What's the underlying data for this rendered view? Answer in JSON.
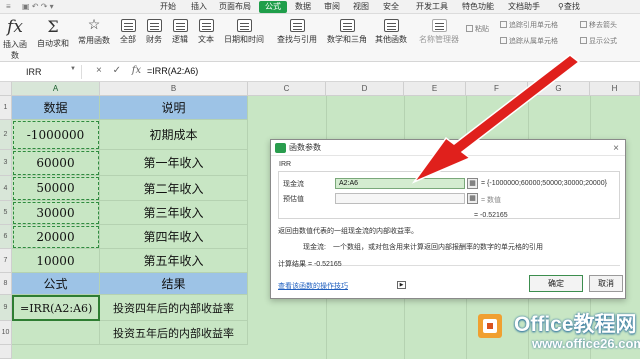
{
  "ribbon": {
    "tabs": [
      "开始",
      "插入",
      "页面布局",
      "公式",
      "数据",
      "审阅",
      "视图",
      "安全",
      "开发工具",
      "特色功能",
      "文档助手"
    ],
    "active_tab": "公式",
    "search_label": "查找",
    "buttons": [
      {
        "label": "插入函数",
        "icon": "fx"
      },
      {
        "label": "自动求和",
        "icon": "Σ"
      },
      {
        "label": "常用函数",
        "icon": "star"
      },
      {
        "label": "全部",
        "icon": "grid"
      },
      {
        "label": "财务",
        "icon": "grid"
      },
      {
        "label": "逻辑",
        "icon": "grid"
      },
      {
        "label": "文本",
        "icon": "grid"
      },
      {
        "label": "日期和时间",
        "icon": "grid"
      },
      {
        "label": "查找与引用",
        "icon": "grid"
      },
      {
        "label": "数学和三角",
        "icon": "grid"
      },
      {
        "label": "其他函数",
        "icon": "grid"
      }
    ],
    "name_manager": "名称管理器",
    "paste": "粘贴",
    "right_items": [
      "追踪引用单元格",
      "追踪从属单元格",
      "移去箭头",
      "显示公式"
    ]
  },
  "formula_bar": {
    "name_box": "IRR",
    "cancel_icon": "×",
    "confirm_icon": "✓",
    "fx_label": "fx",
    "formula": "=IRR(A2:A6)"
  },
  "columns": [
    "A",
    "B",
    "C",
    "D",
    "E",
    "F",
    "G",
    "H"
  ],
  "rows": [
    "1",
    "2",
    "3",
    "4",
    "5",
    "6",
    "7",
    "8",
    "9",
    "10"
  ],
  "sheet": {
    "headers": {
      "a": "数据",
      "b": "说明"
    },
    "data": [
      {
        "a": "-1000000",
        "b": "初期成本"
      },
      {
        "a": "60000",
        "b": "第一年收入"
      },
      {
        "a": "50000",
        "b": "第二年收入"
      },
      {
        "a": "30000",
        "b": "第三年收入"
      },
      {
        "a": "20000",
        "b": "第四年收入"
      },
      {
        "a": "10000",
        "b": "第五年收入"
      }
    ],
    "header2": {
      "a": "公式",
      "b": "结果"
    },
    "row9": {
      "a": "=IRR(A2:A6)",
      "b": "投资四年后的内部收益率"
    },
    "row10": {
      "a": "",
      "b": "投资五年后的内部收益率"
    }
  },
  "dialog": {
    "title": "函数参数",
    "close": "×",
    "function_name": "IRR",
    "arg1_label": "现金流",
    "arg1_value": "A2:A6",
    "arg1_result": "= {-1000000;60000;50000;30000;20000}",
    "arg2_label": "预估值",
    "arg2_result": "= 数值",
    "eq_result": "= -0.52165",
    "description": "返回由数值代表的一组现金流的内部收益率。",
    "arg_desc_label": "现金流:",
    "arg_desc": "一个数组，或对包含用来计算返回内部报酬率的数字的单元格的引用",
    "calc_result": "计算结果 = -0.52165",
    "help_link": "查看该函数的操作技巧",
    "ok": "确定",
    "cancel": "取消"
  },
  "watermark": {
    "line1": "Office教程网",
    "line2": "www.office26.com"
  },
  "colors": {
    "accent": "#1f9e4a",
    "sheet_bg": "#c8e6c4",
    "header_blue": "#9dc3e6",
    "arrow": "#e0201c"
  }
}
